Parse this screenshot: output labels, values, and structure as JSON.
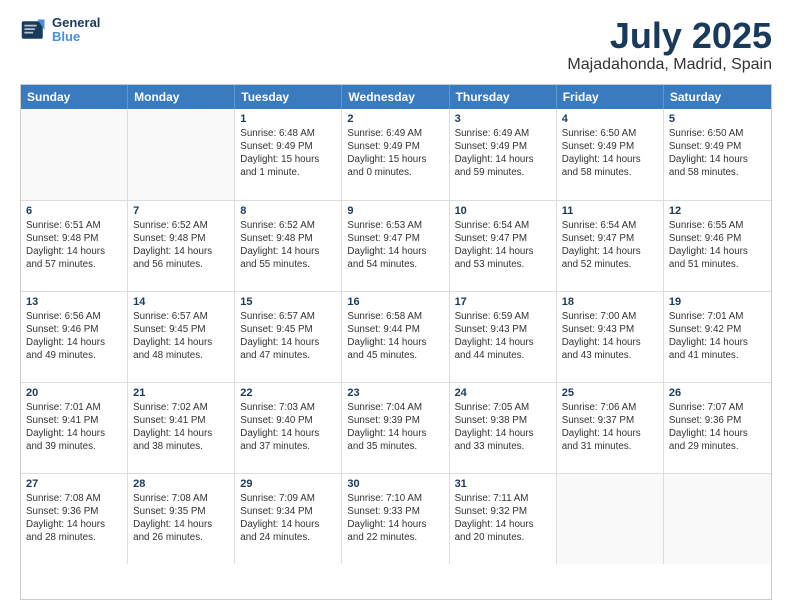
{
  "header": {
    "logo_general": "General",
    "logo_blue": "Blue",
    "title": "July 2025",
    "subtitle": "Majadahonda, Madrid, Spain"
  },
  "weekdays": [
    "Sunday",
    "Monday",
    "Tuesday",
    "Wednesday",
    "Thursday",
    "Friday",
    "Saturday"
  ],
  "weeks": [
    [
      {
        "day": "",
        "empty": true
      },
      {
        "day": "",
        "empty": true
      },
      {
        "day": "1",
        "sunrise": "6:48 AM",
        "sunset": "9:49 PM",
        "daylight": "15 hours and 1 minute."
      },
      {
        "day": "2",
        "sunrise": "6:49 AM",
        "sunset": "9:49 PM",
        "daylight": "15 hours and 0 minutes."
      },
      {
        "day": "3",
        "sunrise": "6:49 AM",
        "sunset": "9:49 PM",
        "daylight": "14 hours and 59 minutes."
      },
      {
        "day": "4",
        "sunrise": "6:50 AM",
        "sunset": "9:49 PM",
        "daylight": "14 hours and 58 minutes."
      },
      {
        "day": "5",
        "sunrise": "6:50 AM",
        "sunset": "9:49 PM",
        "daylight": "14 hours and 58 minutes."
      }
    ],
    [
      {
        "day": "6",
        "sunrise": "6:51 AM",
        "sunset": "9:48 PM",
        "daylight": "14 hours and 57 minutes."
      },
      {
        "day": "7",
        "sunrise": "6:52 AM",
        "sunset": "9:48 PM",
        "daylight": "14 hours and 56 minutes."
      },
      {
        "day": "8",
        "sunrise": "6:52 AM",
        "sunset": "9:48 PM",
        "daylight": "14 hours and 55 minutes."
      },
      {
        "day": "9",
        "sunrise": "6:53 AM",
        "sunset": "9:47 PM",
        "daylight": "14 hours and 54 minutes."
      },
      {
        "day": "10",
        "sunrise": "6:54 AM",
        "sunset": "9:47 PM",
        "daylight": "14 hours and 53 minutes."
      },
      {
        "day": "11",
        "sunrise": "6:54 AM",
        "sunset": "9:47 PM",
        "daylight": "14 hours and 52 minutes."
      },
      {
        "day": "12",
        "sunrise": "6:55 AM",
        "sunset": "9:46 PM",
        "daylight": "14 hours and 51 minutes."
      }
    ],
    [
      {
        "day": "13",
        "sunrise": "6:56 AM",
        "sunset": "9:46 PM",
        "daylight": "14 hours and 49 minutes."
      },
      {
        "day": "14",
        "sunrise": "6:57 AM",
        "sunset": "9:45 PM",
        "daylight": "14 hours and 48 minutes."
      },
      {
        "day": "15",
        "sunrise": "6:57 AM",
        "sunset": "9:45 PM",
        "daylight": "14 hours and 47 minutes."
      },
      {
        "day": "16",
        "sunrise": "6:58 AM",
        "sunset": "9:44 PM",
        "daylight": "14 hours and 45 minutes."
      },
      {
        "day": "17",
        "sunrise": "6:59 AM",
        "sunset": "9:43 PM",
        "daylight": "14 hours and 44 minutes."
      },
      {
        "day": "18",
        "sunrise": "7:00 AM",
        "sunset": "9:43 PM",
        "daylight": "14 hours and 43 minutes."
      },
      {
        "day": "19",
        "sunrise": "7:01 AM",
        "sunset": "9:42 PM",
        "daylight": "14 hours and 41 minutes."
      }
    ],
    [
      {
        "day": "20",
        "sunrise": "7:01 AM",
        "sunset": "9:41 PM",
        "daylight": "14 hours and 39 minutes."
      },
      {
        "day": "21",
        "sunrise": "7:02 AM",
        "sunset": "9:41 PM",
        "daylight": "14 hours and 38 minutes."
      },
      {
        "day": "22",
        "sunrise": "7:03 AM",
        "sunset": "9:40 PM",
        "daylight": "14 hours and 37 minutes."
      },
      {
        "day": "23",
        "sunrise": "7:04 AM",
        "sunset": "9:39 PM",
        "daylight": "14 hours and 35 minutes."
      },
      {
        "day": "24",
        "sunrise": "7:05 AM",
        "sunset": "9:38 PM",
        "daylight": "14 hours and 33 minutes."
      },
      {
        "day": "25",
        "sunrise": "7:06 AM",
        "sunset": "9:37 PM",
        "daylight": "14 hours and 31 minutes."
      },
      {
        "day": "26",
        "sunrise": "7:07 AM",
        "sunset": "9:36 PM",
        "daylight": "14 hours and 29 minutes."
      }
    ],
    [
      {
        "day": "27",
        "sunrise": "7:08 AM",
        "sunset": "9:36 PM",
        "daylight": "14 hours and 28 minutes."
      },
      {
        "day": "28",
        "sunrise": "7:08 AM",
        "sunset": "9:35 PM",
        "daylight": "14 hours and 26 minutes."
      },
      {
        "day": "29",
        "sunrise": "7:09 AM",
        "sunset": "9:34 PM",
        "daylight": "14 hours and 24 minutes."
      },
      {
        "day": "30",
        "sunrise": "7:10 AM",
        "sunset": "9:33 PM",
        "daylight": "14 hours and 22 minutes."
      },
      {
        "day": "31",
        "sunrise": "7:11 AM",
        "sunset": "9:32 PM",
        "daylight": "14 hours and 20 minutes."
      },
      {
        "day": "",
        "empty": true
      },
      {
        "day": "",
        "empty": true
      }
    ]
  ]
}
